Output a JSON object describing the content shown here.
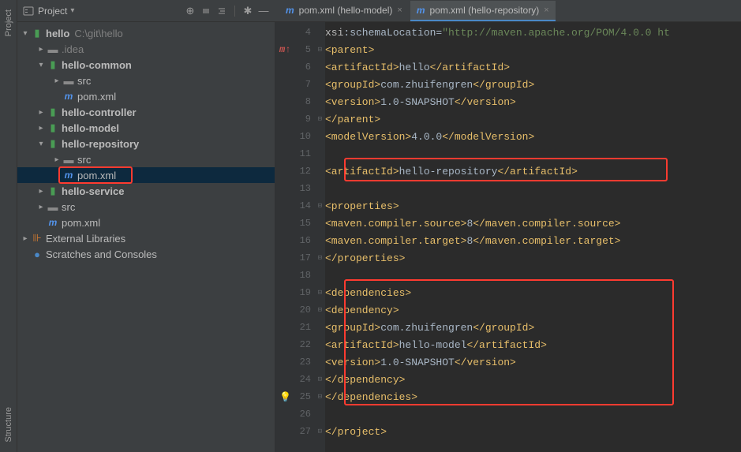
{
  "sidebar": {
    "title": "Project",
    "root": {
      "name": "hello",
      "path": "C:\\git\\hello"
    },
    "idea": ".idea",
    "common": "hello-common",
    "common_src": "src",
    "common_pom": "pom.xml",
    "controller": "hello-controller",
    "model": "hello-model",
    "repository": "hello-repository",
    "repository_src": "src",
    "repository_pom": "pom.xml",
    "service": "hello-service",
    "root_src": "src",
    "root_pom": "pom.xml",
    "ext_lib": "External Libraries",
    "scratch": "Scratches and Consoles"
  },
  "tabs": [
    {
      "label": "pom.xml (hello-model)",
      "active": false
    },
    {
      "label": "pom.xml (hello-repository)",
      "active": true
    }
  ],
  "code": {
    "lines": [
      4,
      5,
      6,
      7,
      8,
      9,
      10,
      11,
      12,
      13,
      14,
      15,
      16,
      17,
      18,
      19,
      20,
      21,
      22,
      23,
      24,
      25,
      26,
      27
    ],
    "l4_attr": "xsi",
    "l4_attr2": ":schemaLocation=",
    "l4_val": "\"http://maven.apache.org/POM/4.0.0 ht",
    "l5": "<parent>",
    "l6a": "<artifactId>",
    "l6b": "hello",
    "l6c": "</artifactId>",
    "l7a": "<groupId>",
    "l7b": "com.zhuifengren",
    "l7c": "</groupId>",
    "l8a": "<version>",
    "l8b": "1.0-SNAPSHOT",
    "l8c": "</version>",
    "l9": "</parent>",
    "l10a": "<modelVersion>",
    "l10b": "4.0.0",
    "l10c": "</modelVersion>",
    "l12a": "<artifactId>",
    "l12b": "hello-repository",
    "l12c": "</artifactId>",
    "l14": "<properties>",
    "l15a": "<maven.compiler.source>",
    "l15b": "8",
    "l15c": "</maven.compiler.source>",
    "l16a": "<maven.compiler.target>",
    "l16b": "8",
    "l16c": "</maven.compiler.target>",
    "l17": "</properties>",
    "l19": "<dependencies>",
    "l20": "<dependency>",
    "l21a": "<groupId>",
    "l21b": "com.zhuifengren",
    "l21c": "</groupId>",
    "l22a": "<artifactId>",
    "l22b": "hello-model",
    "l22c": "</artifactId>",
    "l23a": "<version>",
    "l23b": "1.0-SNAPSHOT",
    "l23c": "</version>",
    "l24": "</dependency>",
    "l25": "</dependencies>",
    "l27": "</project>"
  },
  "rail": {
    "project": "Project",
    "structure": "Structure"
  }
}
